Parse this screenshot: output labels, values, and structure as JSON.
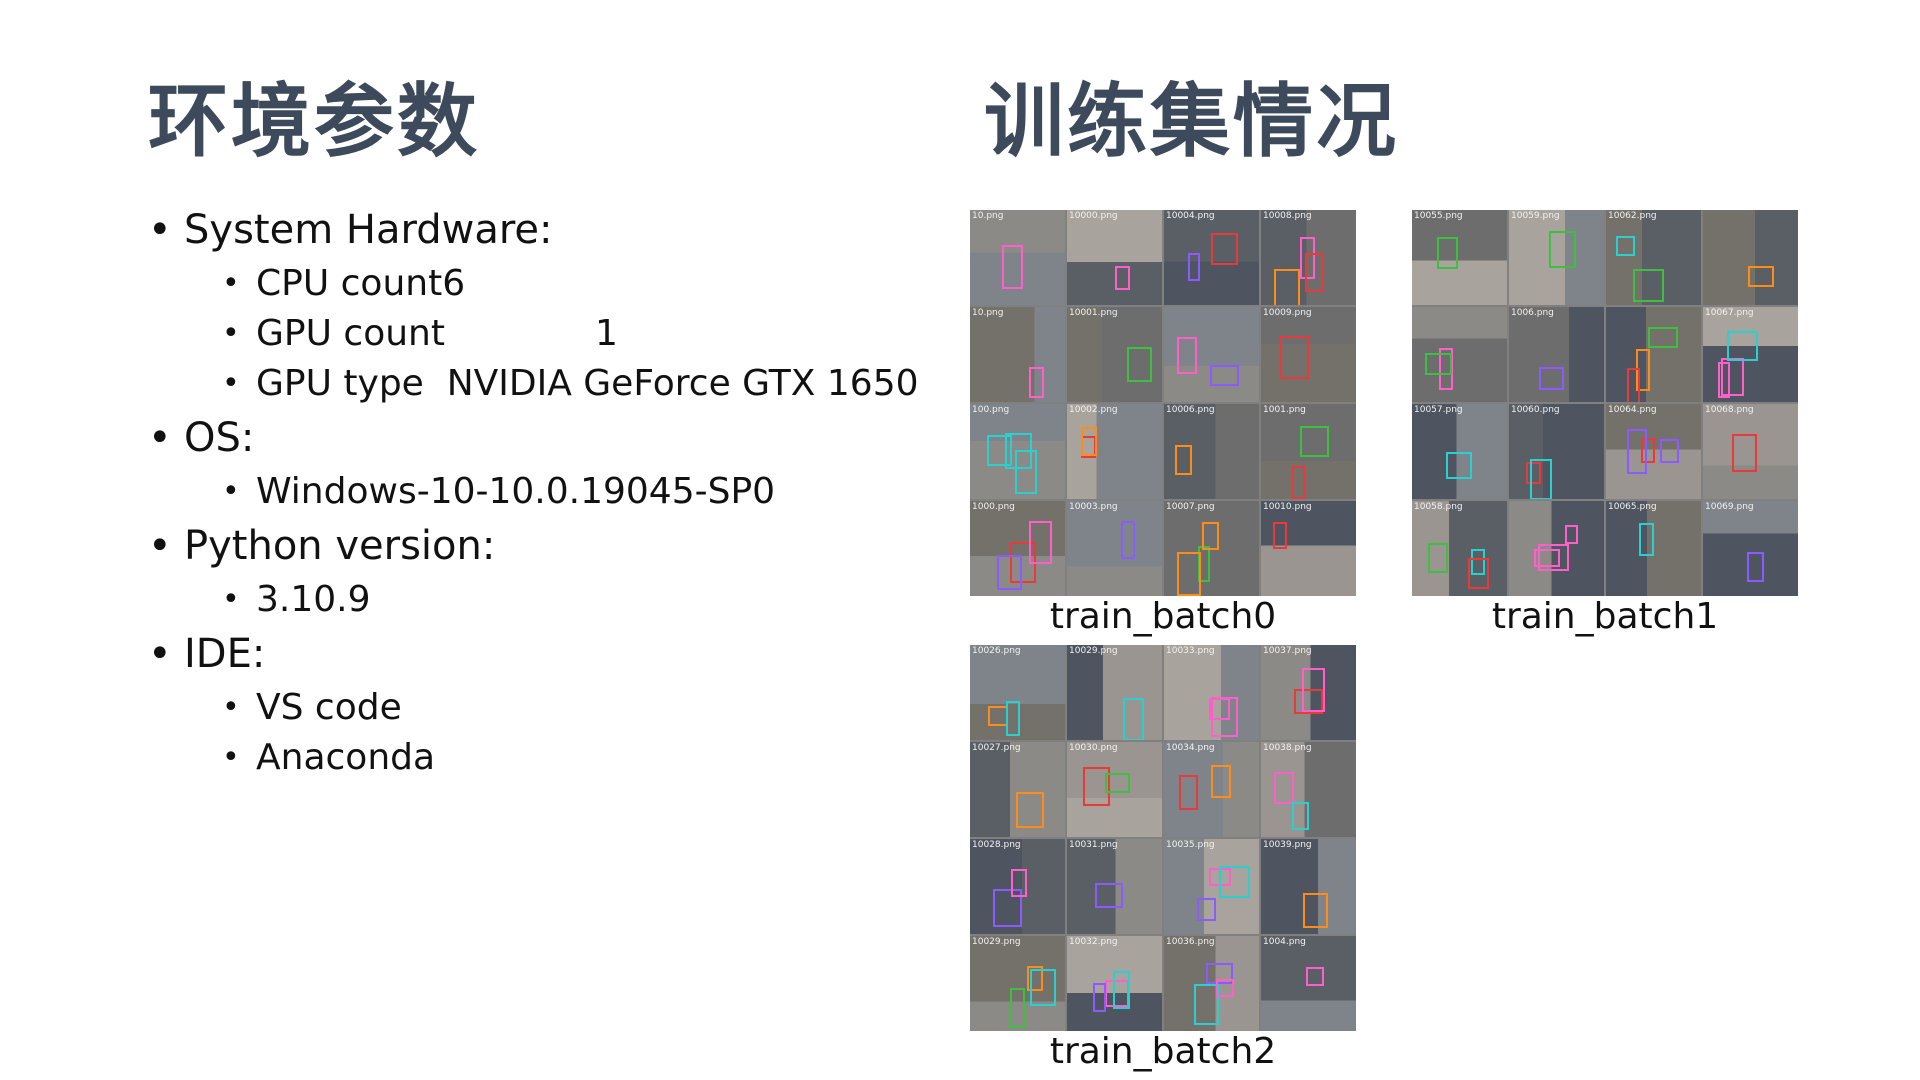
{
  "left": {
    "title": "环境参数",
    "sections": [
      {
        "label": "System Hardware:",
        "items": [
          "CPU count6",
          "GPU count",
          "GPU type  NVIDIA GeForce GTX 1650"
        ],
        "gpu_count_value": "1"
      },
      {
        "label": "OS:",
        "items": [
          "Windows-10-10.0.19045-SP0"
        ]
      },
      {
        "label": "Python version:",
        "items": [
          "3.10.9"
        ]
      },
      {
        "label": "IDE:",
        "items": [
          "VS code",
          "Anaconda"
        ]
      }
    ]
  },
  "right": {
    "title": "训练集情况",
    "batches": [
      {
        "caption": "train_batch0",
        "files": [
          "10.png",
          "10000.png",
          "10004.png",
          "10008.png",
          "10.png",
          "10001.png",
          "",
          "10009.png",
          "100.png",
          "10002.png",
          "10006.png",
          "1001.png",
          "1000.png",
          "10003.png",
          "10007.png",
          "10010.png"
        ]
      },
      {
        "caption": "train_batch1",
        "files": [
          "10055.png",
          "10059.png",
          "10062.png",
          "",
          "",
          "1006.png",
          "",
          "10067.png",
          "10057.png",
          "10060.png",
          "10064.png",
          "10068.png",
          "10058.png",
          "",
          "10065.png",
          "10069.png"
        ]
      },
      {
        "caption": "train_batch2",
        "files": [
          "10026.png",
          "10029.png",
          "10033.png",
          "10037.png",
          "10027.png",
          "10030.png",
          "10034.png",
          "10038.png",
          "10028.png",
          "10031.png",
          "10035.png",
          "10039.png",
          "10029.png",
          "10032.png",
          "10036.png",
          "1004.png"
        ]
      }
    ]
  },
  "colors": {
    "title": "#3c4a5c",
    "box_colors": [
      "#ff8c1a",
      "#e83a3a",
      "#3fbf3f",
      "#8a5cff",
      "#2ad0d0",
      "#ff5fc8"
    ]
  }
}
